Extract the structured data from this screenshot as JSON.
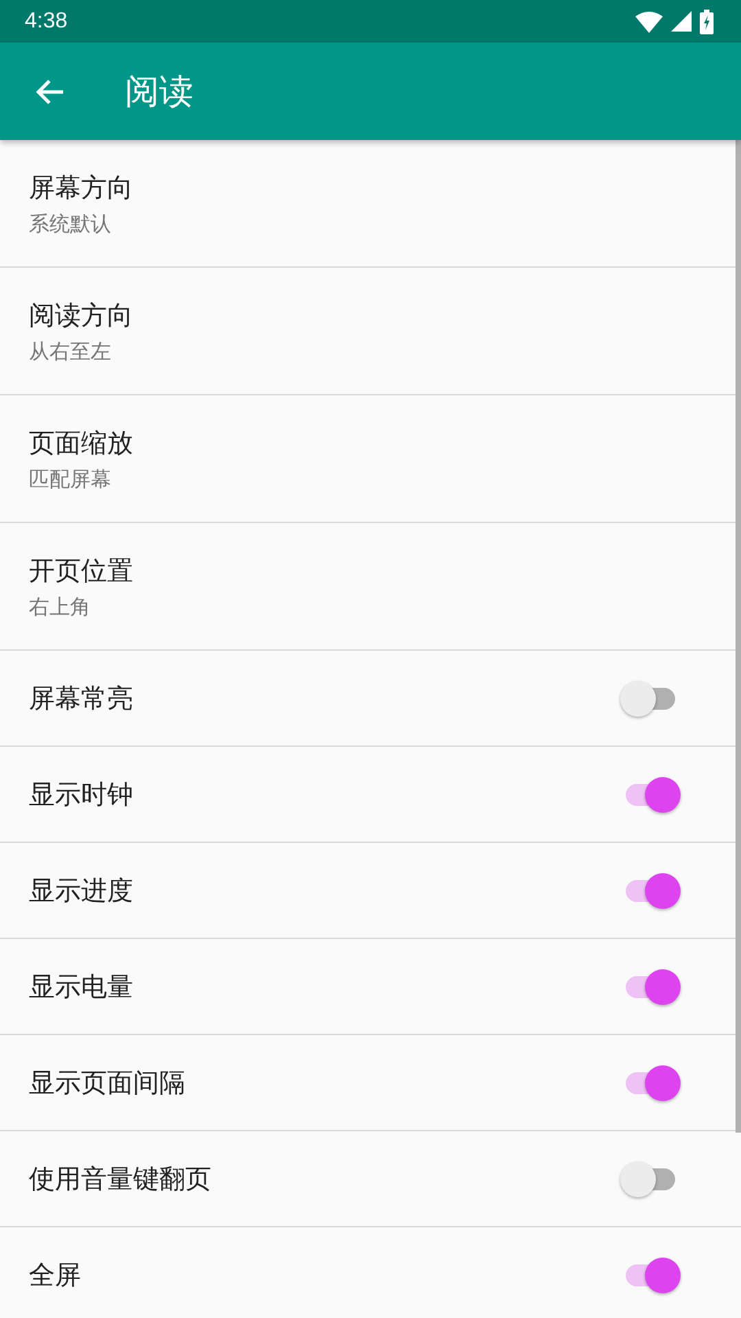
{
  "status_bar": {
    "time": "4:38"
  },
  "toolbar": {
    "title": "阅读"
  },
  "settings": [
    {
      "kind": "choice",
      "title": "屏幕方向",
      "summary": "系统默认"
    },
    {
      "kind": "choice",
      "title": "阅读方向",
      "summary": "从右至左"
    },
    {
      "kind": "choice",
      "title": "页面缩放",
      "summary": "匹配屏幕"
    },
    {
      "kind": "choice",
      "title": "开页位置",
      "summary": "右上角"
    },
    {
      "kind": "switch",
      "title": "屏幕常亮",
      "on": false
    },
    {
      "kind": "switch",
      "title": "显示时钟",
      "on": true
    },
    {
      "kind": "switch",
      "title": "显示进度",
      "on": true
    },
    {
      "kind": "switch",
      "title": "显示电量",
      "on": true
    },
    {
      "kind": "switch",
      "title": "显示页面间隔",
      "on": true
    },
    {
      "kind": "switch",
      "title": "使用音量键翻页",
      "on": false
    },
    {
      "kind": "switch",
      "title": "全屏",
      "on": true
    }
  ]
}
